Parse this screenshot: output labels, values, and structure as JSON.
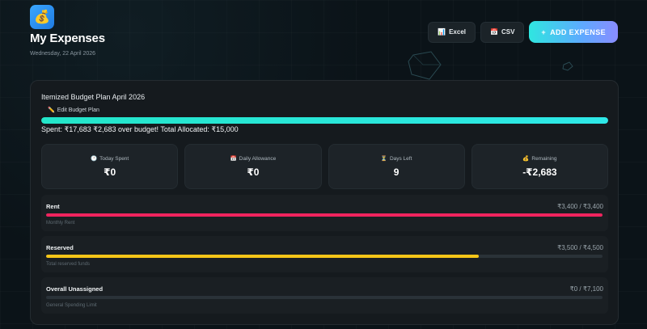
{
  "header": {
    "logo_icon": "money-bag-icon",
    "logo_glyph": "💰",
    "title": "My Expenses",
    "date": "Wednesday, 22 April 2026"
  },
  "actions": {
    "excel": {
      "icon": "📊",
      "label": "Excel"
    },
    "csv": {
      "icon": "📅",
      "label": "CSV"
    },
    "add": {
      "icon": "+",
      "label": "ADD EXPENSE"
    }
  },
  "plan": {
    "title": "Itemized Budget Plan April 2026",
    "edit": {
      "icon": "✏️",
      "label": "Edit Budget Plan"
    },
    "progress_fraction": 1.0,
    "summary": "Spent: ₹17,683 ₹2,683 over budget! Total Allocated: ₹15,000"
  },
  "stats": [
    {
      "icon": "🕐",
      "label": "Today Spent",
      "value": "₹0"
    },
    {
      "icon": "📅",
      "label": "Daily Allowance",
      "value": "₹0"
    },
    {
      "icon": "⏳",
      "label": "Days Left",
      "value": "9"
    },
    {
      "icon": "💰",
      "label": "Remaining",
      "value": "-₹2,683"
    }
  ],
  "categories": [
    {
      "name": "Rent",
      "amount": "₹3,400 / ₹3,400",
      "desc": "Monthly Rent",
      "fraction": 1.0,
      "color": "#f0245e"
    },
    {
      "name": "Reserved",
      "amount": "₹3,500 / ₹4,500",
      "desc": "Total reserved funds",
      "fraction": 0.778,
      "color": "#f5c518"
    },
    {
      "name": "Overall Unassigned",
      "amount": "₹0 / ₹7,100",
      "desc": "General Spending Limit",
      "fraction": 0.0,
      "color": "#3a7bd5"
    }
  ],
  "colors": {
    "accent_cyan": "#2ee8e8",
    "rent": "#f0245e",
    "reserved": "#f5c518"
  }
}
